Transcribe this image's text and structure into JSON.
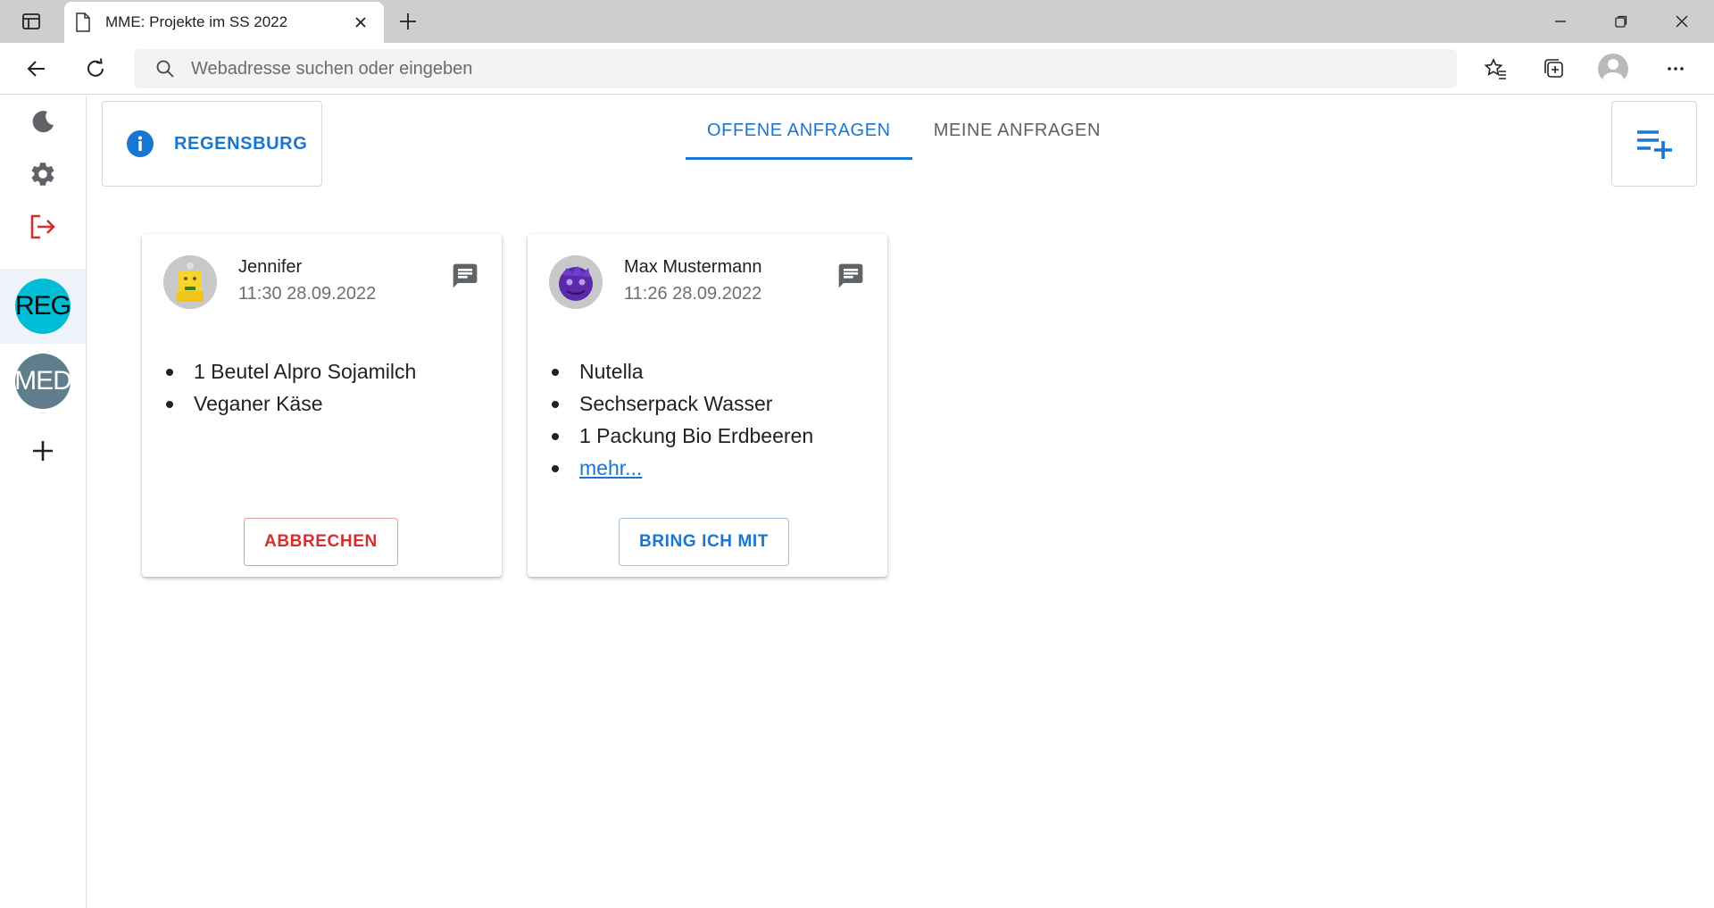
{
  "browser": {
    "tab_title": "MME: Projekte im SS 2022",
    "address_placeholder": "Webadresse suchen oder eingeben",
    "icons": [
      "tab-actions-icon",
      "page-icon",
      "close-icon",
      "plus-icon",
      "minimize-icon",
      "restore-icon",
      "window-close-icon",
      "back-icon",
      "reload-icon",
      "search-icon",
      "favorites-icon",
      "collections-icon",
      "profile-icon",
      "more-icon"
    ]
  },
  "sidebar": {
    "groups": [
      {
        "label": "REG",
        "color": "#00bcd4",
        "text_color": "#0b0b0b",
        "active": true
      },
      {
        "label": "MED",
        "color": "#607d8b",
        "text_color": "#ffffff",
        "active": false
      }
    ],
    "colors": {
      "logout": "#d32f2f",
      "icon": "#5f6368"
    }
  },
  "header": {
    "location_label": "REGENSBURG",
    "tabs": [
      {
        "label": "OFFENE ANFRAGEN",
        "active": true
      },
      {
        "label": "MEINE ANFRAGEN",
        "active": false
      }
    ],
    "accent": "#1976d2"
  },
  "requests": [
    {
      "name": "Jennifer",
      "time": "11:30 28.09.2022",
      "items": [
        "1 Beutel Alpro Sojamilch",
        "Veganer Käse"
      ],
      "action_label": "ABBRECHEN",
      "avatar": "yellow-robot"
    },
    {
      "name": "Max Mustermann",
      "time": "11:26 28.09.2022",
      "items": [
        "Nutella",
        "Sechserpack Wasser",
        "1 Packung Bio Erdbeeren"
      ],
      "more_label": "mehr...",
      "action_label": "BRING ICH MIT",
      "avatar": "purple-monster"
    }
  ]
}
